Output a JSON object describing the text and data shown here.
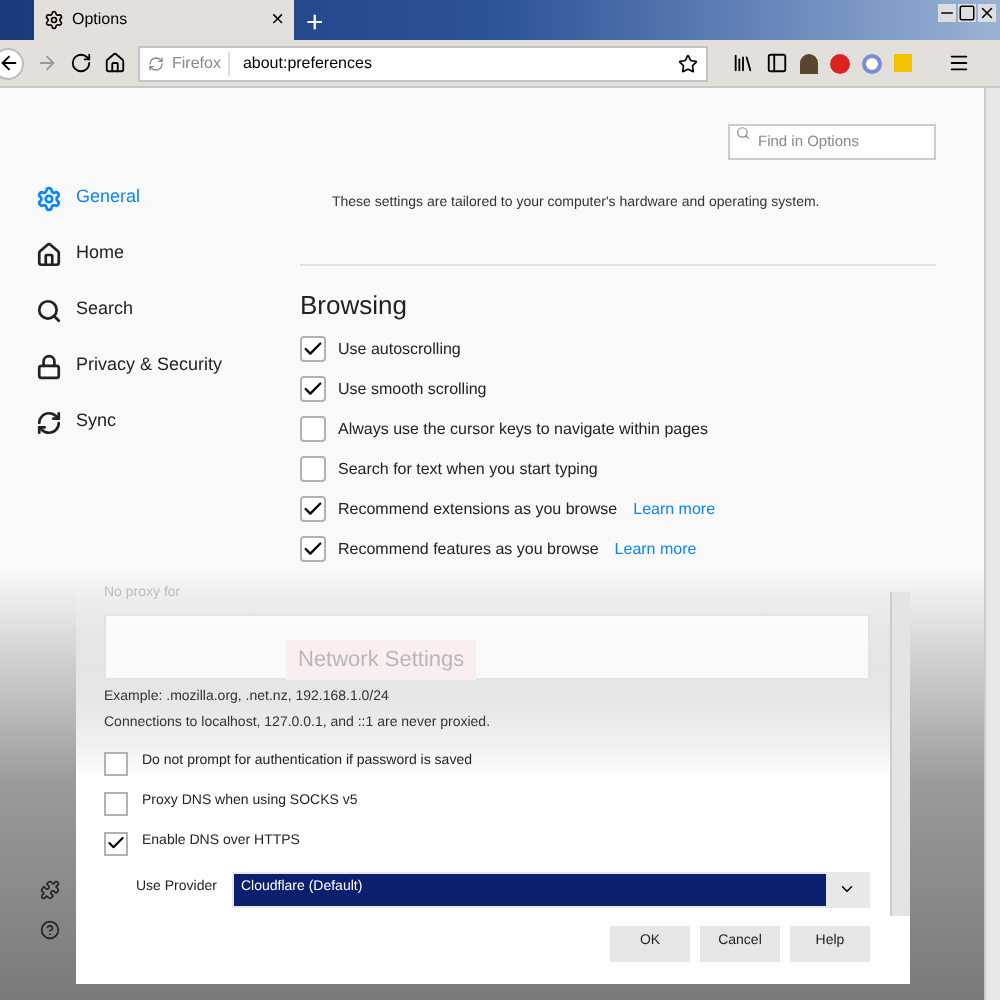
{
  "window": {
    "tab_title": "Options",
    "tab_close": "×",
    "new_tab": "+"
  },
  "toolbar": {
    "identity": "Firefox",
    "url": "about:preferences"
  },
  "search": {
    "placeholder": "Find in Options"
  },
  "sidebar": {
    "items": [
      {
        "label": "General",
        "kind": "gear",
        "selected": true
      },
      {
        "label": "Home",
        "kind": "home",
        "selected": false
      },
      {
        "label": "Search",
        "kind": "search",
        "selected": false
      },
      {
        "label": "Privacy & Security",
        "kind": "lock",
        "selected": false
      },
      {
        "label": "Sync",
        "kind": "sync",
        "selected": false
      }
    ]
  },
  "content": {
    "description": "These settings are tailored to your computer's hardware and operating system.",
    "section_title": "Browsing",
    "options": [
      {
        "label": "Use autoscrolling",
        "checked": true
      },
      {
        "label": "Use smooth scrolling",
        "checked": true
      },
      {
        "label": "Always use the cursor keys to navigate within pages",
        "checked": false
      },
      {
        "label": "Search for text when you start typing",
        "checked": false
      },
      {
        "label": "Recommend extensions as you browse",
        "checked": true,
        "link": "Learn more"
      },
      {
        "label": "Recommend features as you browse",
        "checked": true,
        "link": "Learn more"
      }
    ]
  },
  "dialog": {
    "behind_title": "Network Settings",
    "no_proxy_label": "No proxy for",
    "example": "Example: .mozilla.org, .net.nz, 192.168.1.0/24",
    "note": "Connections to localhost, 127.0.0.1, and ::1 are never proxied.",
    "options": [
      {
        "label": "Do not prompt for authentication if password is saved",
        "checked": false
      },
      {
        "label": "Proxy DNS when using SOCKS v5",
        "checked": false
      },
      {
        "label": "Enable DNS over HTTPS",
        "checked": true
      }
    ],
    "provider": {
      "label": "Use Provider",
      "value": "Cloudflare (Default)"
    },
    "buttons": [
      "OK",
      "Cancel",
      "Help"
    ]
  }
}
